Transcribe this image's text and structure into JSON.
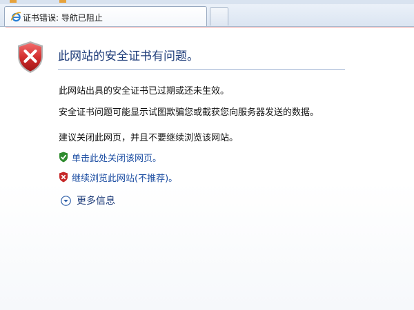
{
  "browser": {
    "tab": {
      "title": "证书错误: 导航已阻止",
      "icon": "ie-icon"
    },
    "new_tab": {
      "icon": "new-tab-icon"
    }
  },
  "page": {
    "heading": "此网站的安全证书有问题。",
    "paragraphs": [
      "此网站出具的安全证书已过期或还未生效。",
      "安全证书问题可能显示试图欺骗您或截获您向服务器发送的数据。",
      "建议关闭此网页，并且不要继续浏览该网站。"
    ],
    "links": {
      "close": {
        "label": "单击此处关闭该网页。",
        "icon": "green-shield-check-icon"
      },
      "continue": {
        "label": "继续浏览此网站(不推荐)。",
        "icon": "red-shield-x-icon"
      },
      "more_info": {
        "label": "更多信息",
        "icon": "expand-down-icon"
      }
    },
    "icons": {
      "main": "red-shield-x-icon"
    },
    "colors": {
      "heading": "#1f3d7a",
      "link": "#1e4fa3",
      "error_red": "#c62828",
      "safe_green": "#2e8b2e"
    }
  }
}
